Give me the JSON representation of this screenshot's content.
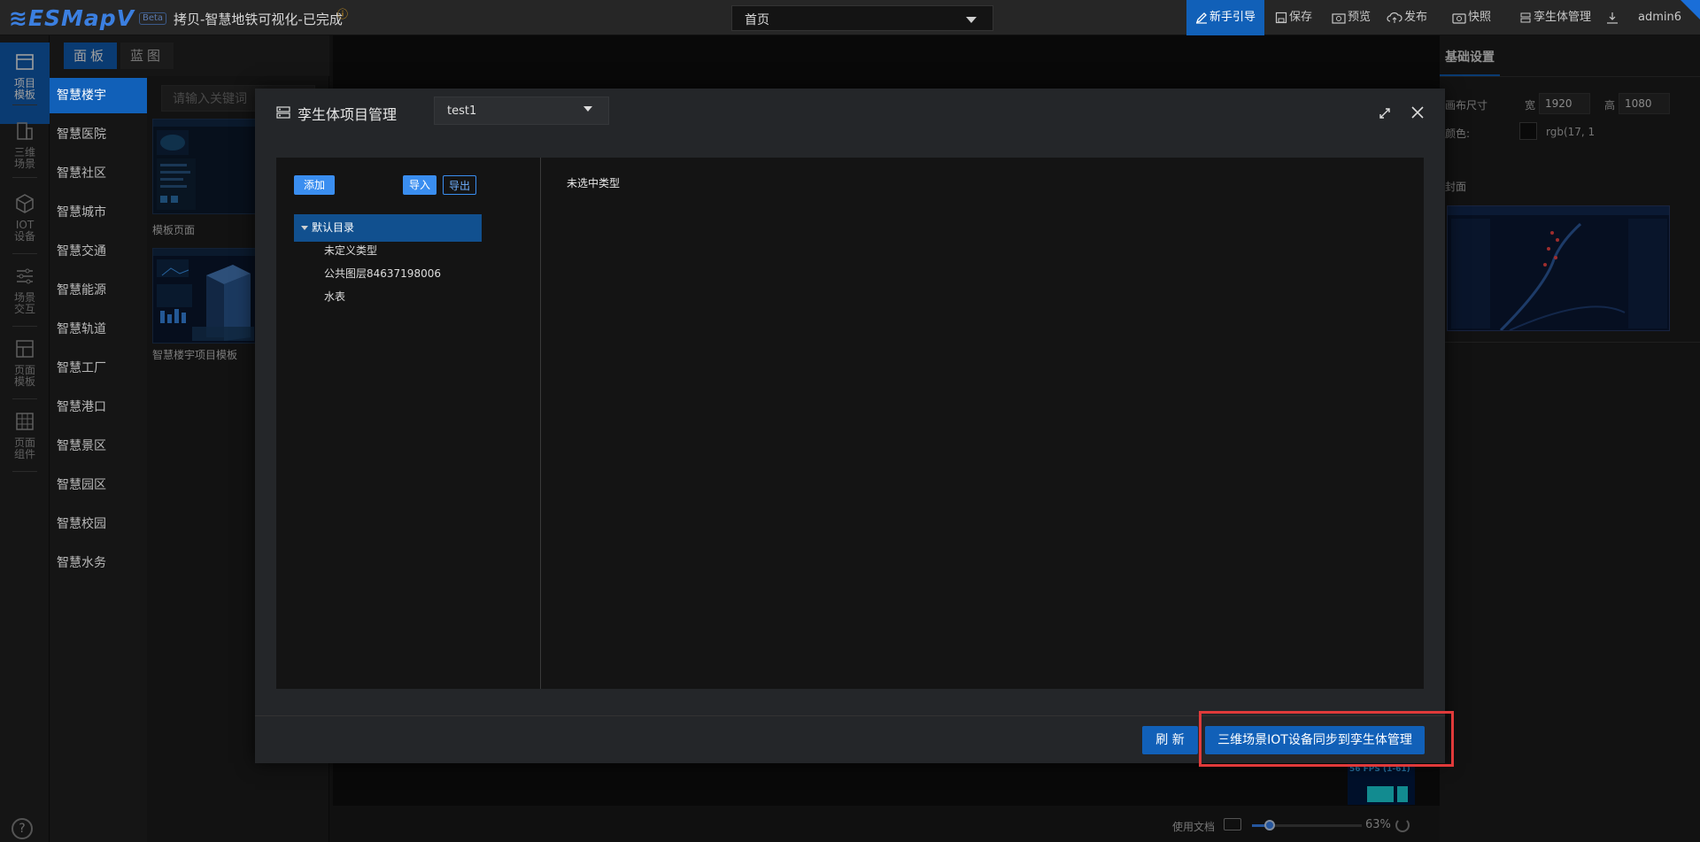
{
  "topbar": {
    "logo": "ESMapV",
    "beta": "Beta",
    "project_title": "拷贝-智慧地铁可视化-已完成",
    "page_select": "首页",
    "items": {
      "guide": "新手引导",
      "save": "保存",
      "preview": "预览",
      "publish": "发布",
      "snapshot": "快照",
      "twin": "孪生体管理",
      "user": "admin6"
    }
  },
  "rail": [
    {
      "label1": "项目",
      "label2": "模板",
      "icon": "template-icon"
    },
    {
      "label1": "三维",
      "label2": "场景",
      "icon": "building-icon"
    },
    {
      "label1": "IOT",
      "label2": "设备",
      "icon": "cube-icon"
    },
    {
      "label1": "场景",
      "label2": "交互",
      "icon": "sliders-icon"
    },
    {
      "label1": "页面",
      "label2": "模板",
      "icon": "layout-icon"
    },
    {
      "label1": "页面",
      "label2": "组件",
      "icon": "grid-icon"
    }
  ],
  "panel_tabs": {
    "panel": "面板",
    "blueprint": "蓝图"
  },
  "categories": [
    "智慧楼宇",
    "智慧医院",
    "智慧社区",
    "智慧城市",
    "智慧交通",
    "智慧能源",
    "智慧轨道",
    "智慧工厂",
    "智慧港口",
    "智慧景区",
    "智慧园区",
    "智慧校园",
    "智慧水务"
  ],
  "template_search": {
    "placeholder": "请输入关键词"
  },
  "templates": [
    {
      "caption": "模板页面"
    },
    {
      "caption": "智慧楼宇项目模板"
    }
  ],
  "fps": {
    "text": "56 FPS (1-61)"
  },
  "bottom": {
    "doc": "使用文档",
    "zoom": "63%",
    "zoom_value": 0.63
  },
  "right_panel": {
    "tab": "基础设置",
    "canvas_size_label": "画布尺寸",
    "width_label": "宽",
    "width_value": "1920",
    "height_label": "高",
    "height_value": "1080",
    "color_label": "颜色:",
    "color_value": "rgb(17, 1",
    "cover_label": "封面"
  },
  "modal": {
    "title": "孪生体项目管理",
    "project_select": "test1",
    "buttons": {
      "add": "添加",
      "import": "导入",
      "export": "导出"
    },
    "tree": [
      {
        "label": "默认目录",
        "selected": true
      },
      {
        "label": "未定义类型"
      },
      {
        "label": "公共图层84637198006"
      },
      {
        "label": "水表"
      }
    ],
    "empty_text": "未选中类型",
    "footer": {
      "refresh": "刷 新",
      "sync": "三维场景IOT设备同步到孪生体管理"
    }
  }
}
